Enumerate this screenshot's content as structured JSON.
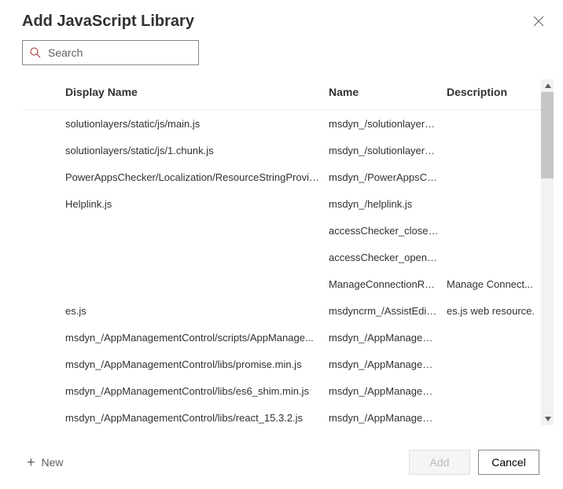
{
  "dialog": {
    "title": "Add JavaScript Library",
    "search_placeholder": "Search"
  },
  "columns": {
    "display_name": "Display Name",
    "name": "Name",
    "description": "Description"
  },
  "rows": [
    {
      "display": "solutionlayers/static/js/main.js",
      "name": "msdyn_/solutionlayers/sta...",
      "desc": ""
    },
    {
      "display": "solutionlayers/static/js/1.chunk.js",
      "name": "msdyn_/solutionlayers/sta...",
      "desc": ""
    },
    {
      "display": "PowerAppsChecker/Localization/ResourceStringProvid...",
      "name": "msdyn_/PowerAppsCheck...",
      "desc": ""
    },
    {
      "display": "Helplink.js",
      "name": "msdyn_/helplink.js",
      "desc": ""
    },
    {
      "display": "",
      "name": "accessChecker_closeDialo...",
      "desc": ""
    },
    {
      "display": "",
      "name": "accessChecker_openDialo...",
      "desc": ""
    },
    {
      "display": "",
      "name": "ManageConnectionRoles...",
      "desc": "Manage Connect..."
    },
    {
      "display": "es.js",
      "name": "msdyncrm_/AssistEditCon...",
      "desc": "es.js web resource."
    },
    {
      "display": "msdyn_/AppManagementControl/scripts/AppManage...",
      "name": "msdyn_/AppManagement...",
      "desc": ""
    },
    {
      "display": "msdyn_/AppManagementControl/libs/promise.min.js",
      "name": "msdyn_/AppManagement...",
      "desc": ""
    },
    {
      "display": "msdyn_/AppManagementControl/libs/es6_shim.min.js",
      "name": "msdyn_/AppManagement...",
      "desc": ""
    },
    {
      "display": "msdyn_/AppManagementControl/libs/react_15.3.2.js",
      "name": "msdyn_/AppManagement...",
      "desc": ""
    }
  ],
  "footer": {
    "new_label": "New",
    "add_label": "Add",
    "cancel_label": "Cancel"
  }
}
